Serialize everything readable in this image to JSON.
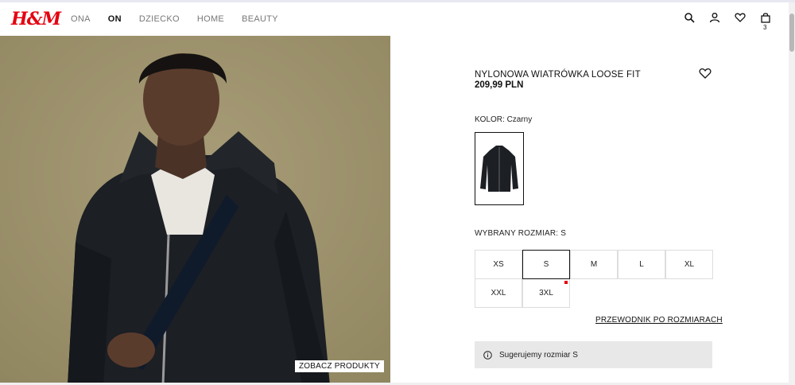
{
  "header": {
    "logo": "H&M",
    "nav": [
      "ONA",
      "ON",
      "DZIECKO",
      "HOME",
      "BEAUTY"
    ],
    "active_nav": "ON",
    "icons": [
      "search-icon",
      "account-icon",
      "favorites-icon",
      "cart-icon"
    ],
    "cart_count": "3"
  },
  "hero": {
    "button_label": "ZOBACZ PRODUKTY"
  },
  "product": {
    "title": "NYLONOWA WIATRÓWKA LOOSE FIT",
    "price": "209,99 PLN",
    "color_label": "KOLOR: Czarny",
    "size_label": "WYBRANY ROZMIAR: S",
    "sizes": [
      "XS",
      "S",
      "M",
      "L",
      "XL",
      "XXL",
      "3XL"
    ],
    "selected_size": "S",
    "low_stock_size": "3XL",
    "size_guide": "PRZEWODNIK PO ROZMIARACH",
    "suggestion": "Sugerujemy rozmiar S"
  },
  "colors": {
    "brand": "#e50010",
    "background_photo": "#9f946e",
    "suggestion_bg": "#e8e8e8"
  }
}
